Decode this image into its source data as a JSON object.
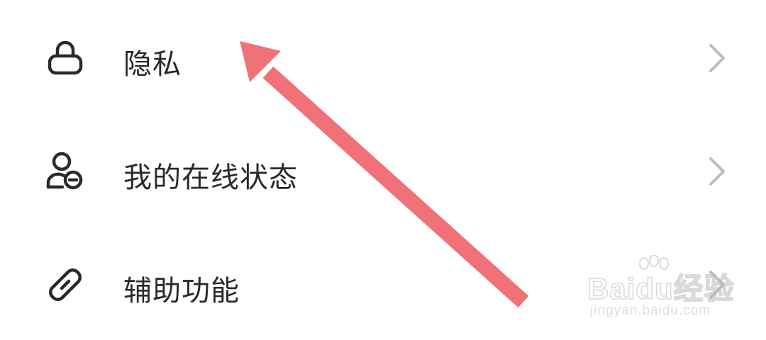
{
  "settings_menu": {
    "items": [
      {
        "label": "隐私",
        "icon": "lock-icon"
      },
      {
        "label": "我的在线状态",
        "icon": "user-status-icon"
      },
      {
        "label": "辅助功能",
        "icon": "link-icon"
      }
    ],
    "chevron_icon": "chevron-right-icon"
  },
  "annotation": {
    "type": "arrow",
    "points_to": "隐私",
    "color": "#f07178"
  },
  "watermark": {
    "brand": "Baidu经验",
    "url": "jingyan.baidu.com"
  },
  "colors": {
    "background": "#ffffff",
    "text": "#2a2a2a",
    "icon": "#2a2a2a",
    "chevron": "#bdbdbd",
    "arrow": "#f07178"
  }
}
